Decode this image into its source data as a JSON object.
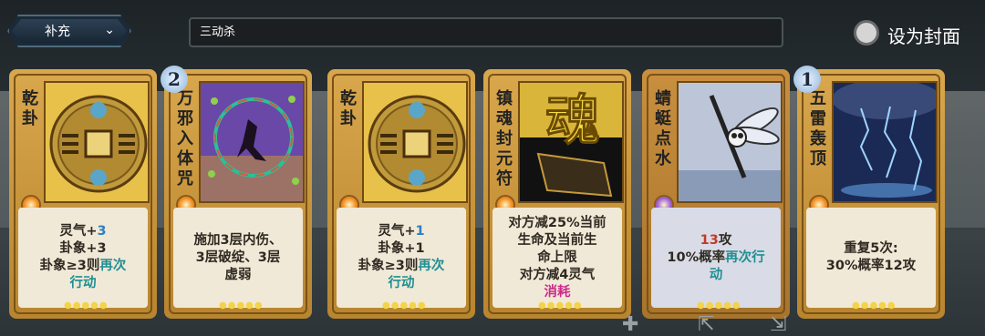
{
  "header": {
    "category_dropdown": {
      "label": "补充",
      "icon": "chevron-down-icon"
    },
    "deck_name": "三动杀",
    "cover_toggle": {
      "label": "设为封面",
      "checked": false
    }
  },
  "cards": [
    {
      "name": "乾卦",
      "cost": "",
      "gem_color": "#f08a1c",
      "art": "coin-emblem",
      "desc_lines": [
        [
          {
            "t": "灵气+"
          },
          {
            "t": "3",
            "c": "blue"
          }
        ],
        [
          {
            "t": "卦象+3"
          }
        ],
        [
          {
            "t": "卦象≥3则"
          },
          {
            "t": "再次",
            "c": "teal"
          }
        ],
        [
          {
            "t": "行动",
            "c": "teal"
          }
        ]
      ]
    },
    {
      "name": "万邪入体咒",
      "cost": "2",
      "gem_color": "#f08a1c",
      "art": "dark-ritual-figure",
      "desc_lines": [
        [
          {
            "t": "施加3层内伤、"
          }
        ],
        [
          {
            "t": "3层破绽、3层"
          }
        ],
        [
          {
            "t": "虚弱"
          }
        ]
      ]
    },
    {
      "name": "乾卦",
      "cost": "",
      "gem_color": "#f08a1c",
      "art": "coin-emblem",
      "desc_lines": [
        [
          {
            "t": "灵气+"
          },
          {
            "t": "1",
            "c": "blue"
          }
        ],
        [
          {
            "t": "卦象+1"
          }
        ],
        [
          {
            "t": "卦象≥3则"
          },
          {
            "t": "再次",
            "c": "teal"
          }
        ],
        [
          {
            "t": "行动",
            "c": "teal"
          }
        ]
      ]
    },
    {
      "name": "镇魂封元符",
      "cost": "",
      "gem_color": "#f08a1c",
      "art": "soul-talisman",
      "art_glyph": "魂",
      "desc_lines": [
        [
          {
            "t": "对方减25%当前"
          }
        ],
        [
          {
            "t": "生命及当前生"
          }
        ],
        [
          {
            "t": "命上限"
          }
        ],
        [
          {
            "t": "对方减4灵气"
          }
        ],
        [
          {
            "t": "消耗",
            "c": "magenta"
          }
        ]
      ]
    },
    {
      "name": "蜻蜓点水",
      "cost": "",
      "gem_color": "#9a5cd6",
      "art": "dragonfly",
      "silver": true,
      "desc_lines": [
        [
          {
            "t": "13",
            "c": "red"
          },
          {
            "t": "攻"
          }
        ],
        [
          {
            "t": "10%概率"
          },
          {
            "t": "再次行",
            "c": "teal"
          }
        ],
        [
          {
            "t": "动",
            "c": "teal"
          }
        ]
      ]
    },
    {
      "name": "五雷轰顶",
      "cost": "1",
      "gem_color": "#f08a1c",
      "art": "thunder-storm",
      "desc_lines": [
        [
          {
            "t": "重复5次:"
          }
        ],
        [
          {
            "t": "30%概率12攻"
          }
        ]
      ]
    }
  ],
  "bottom_icons": [
    "add-icon",
    "deck-remove-icon",
    "deck-export-icon"
  ]
}
